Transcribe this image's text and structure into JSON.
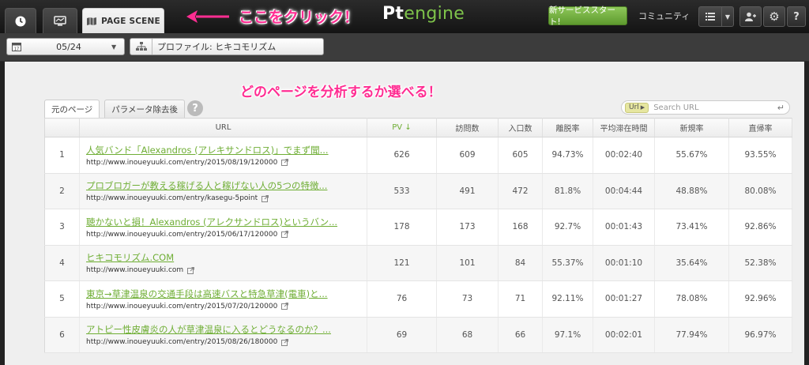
{
  "annotations": {
    "click_here": "ここをクリック！",
    "select_page": "どのページを分析するか選べる！"
  },
  "topbar": {
    "tab_page_scene": "PAGE SCENE",
    "logo_pt": "Pt",
    "logo_engine": "engine",
    "new_service_button": "新サービススタート!",
    "community": "コミュニティ",
    "help": "?"
  },
  "filters": {
    "date": "05/24",
    "profile": "プロファイル: ヒキコモリズム"
  },
  "content": {
    "tabs": [
      "元のページ",
      "パラメータ除去後"
    ],
    "help": "?",
    "search": {
      "pill": "Url",
      "placeholder": "Search URL"
    }
  },
  "table": {
    "headers": [
      "",
      "URL",
      "PV ↓",
      "訪問数",
      "入口数",
      "離脱率",
      "平均滞在時間",
      "新規率",
      "直帰率"
    ],
    "rows": [
      {
        "num": "1",
        "title": "人気バンド「Alexandros (アレキサンドロス)」でまず聞...",
        "url": "http://www.inoueyuuki.com/entry/2015/08/19/120000",
        "pv": "626",
        "visits": "609",
        "entries": "605",
        "exit": "94.73%",
        "avg": "00:02:40",
        "new": "55.67%",
        "bounce": "93.55%"
      },
      {
        "num": "2",
        "title": "プロブロガーが教える稼げる人と稼げない人の5つの特徴...",
        "url": "http://www.inoueyuuki.com/entry/kasegu-5point",
        "pv": "533",
        "visits": "491",
        "entries": "472",
        "exit": "81.8%",
        "avg": "00:04:44",
        "new": "48.88%",
        "bounce": "80.08%"
      },
      {
        "num": "3",
        "title": "聴かないと損！Alexandros (アレクサンドロス)というバン...",
        "url": "http://www.inoueyuuki.com/entry/2015/06/17/120000",
        "pv": "178",
        "visits": "173",
        "entries": "168",
        "exit": "92.7%",
        "avg": "00:01:43",
        "new": "73.41%",
        "bounce": "92.86%"
      },
      {
        "num": "4",
        "title": "ヒキコモリズム.COM",
        "url": "http://www.inoueyuuki.com",
        "pv": "121",
        "visits": "101",
        "entries": "84",
        "exit": "55.37%",
        "avg": "00:01:10",
        "new": "35.64%",
        "bounce": "52.38%"
      },
      {
        "num": "5",
        "title": "東京→草津温泉の交通手段は高速バスと特急草津(電車)と...",
        "url": "http://www.inoueyuuki.com/entry/2015/07/20/120000",
        "pv": "76",
        "visits": "73",
        "entries": "71",
        "exit": "92.11%",
        "avg": "00:01:27",
        "new": "78.08%",
        "bounce": "92.96%"
      },
      {
        "num": "6",
        "title": "アトピー性皮膚炎の人が草津温泉に入るとどうなるのか？...",
        "url": "http://www.inoueyuuki.com/entry/2015/08/26/180000",
        "pv": "69",
        "visits": "68",
        "entries": "66",
        "exit": "97.1%",
        "avg": "00:02:01",
        "new": "77.94%",
        "bounce": "96.97%"
      }
    ]
  }
}
